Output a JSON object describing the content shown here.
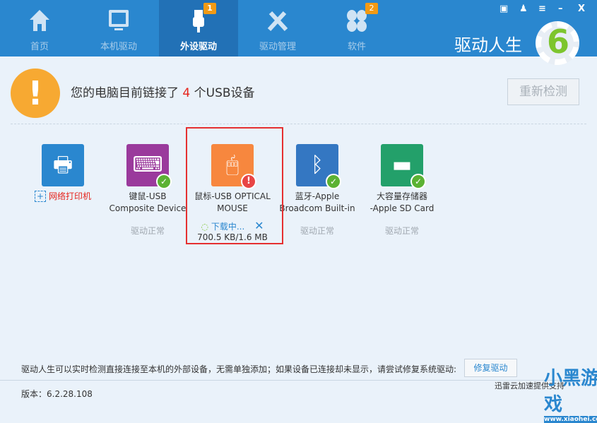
{
  "tabs": [
    {
      "label": "首页",
      "icon": "home-icon"
    },
    {
      "label": "本机驱动",
      "icon": "monitor-icon"
    },
    {
      "label": "外设驱动",
      "icon": "usb-icon",
      "badge": "1",
      "active": true
    },
    {
      "label": "驱动管理",
      "icon": "tools-icon"
    },
    {
      "label": "软件",
      "icon": "software-icon",
      "badge": "2"
    }
  ],
  "window": {
    "feedback": "▣",
    "skin": "♟",
    "menu": "≡",
    "minimize": "–",
    "close": "X"
  },
  "brand": {
    "name": "驱动人生",
    "version_mark": "6"
  },
  "summary": {
    "prefix": "您的电脑目前链接了",
    "count": "4",
    "suffix": "个USB设备",
    "recheck": "重新检测"
  },
  "devices": [
    {
      "name1": "网络打印机",
      "name2": "",
      "status": "",
      "color": "#2a87cf",
      "icon": "printer-add-icon"
    },
    {
      "name1": "键鼠-USB",
      "name2": "Composite Device",
      "status": "驱动正常",
      "color": "#9a3a9c",
      "icon": "keyboard-mouse-icon"
    },
    {
      "name1": "鼠标-USB OPTICAL",
      "name2": "MOUSE",
      "status": "",
      "color": "#f7873e",
      "icon": "mouse-icon",
      "downloading": "下载中...",
      "progress": "700.5 KB/1.6 MB"
    },
    {
      "name1": "蓝牙-Apple",
      "name2": "Broadcom Built-in",
      "status": "驱动正常",
      "color": "#3477c2",
      "icon": "bluetooth-icon"
    },
    {
      "name1": "大容量存储器",
      "name2": "-Apple SD Card",
      "status": "驱动正常",
      "color": "#23a06a",
      "icon": "storage-icon"
    }
  ],
  "footer": {
    "hint": "驱动人生可以实时检测直接连接至本机的外部设备，无需单独添加；如果设备已连接却未显示，请尝试修复系统驱动:",
    "fix_button": "修复驱动",
    "version": "版本：6.2.28.108",
    "powered": "迅雷云加速提供支持"
  },
  "watermark": {
    "text": "小黑游戏",
    "url": "www.xiaohei.com"
  }
}
